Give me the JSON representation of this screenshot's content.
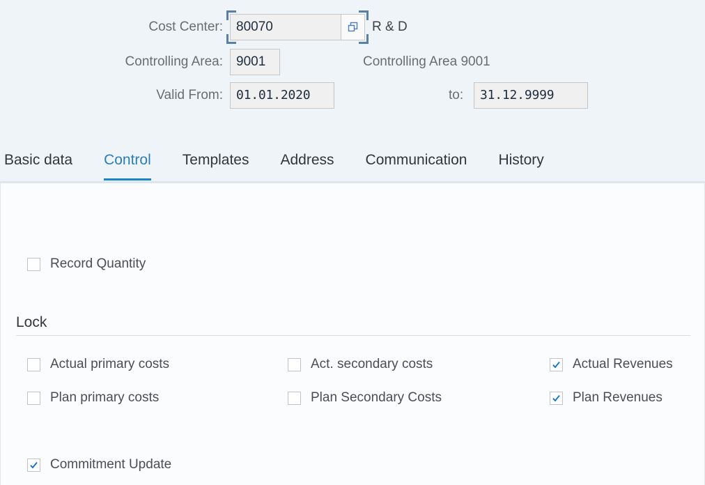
{
  "header": {
    "fields": [
      {
        "label": "Cost Center:",
        "value": "80070",
        "description": "R & D",
        "value_help_icon": "value-help-icon"
      },
      {
        "label": "Controlling Area:",
        "value": "9001",
        "description": "Controlling Area 9001"
      },
      {
        "label": "Valid From:",
        "value": "01.01.2020",
        "to_label": "to:",
        "to_value": "31.12.9999"
      }
    ]
  },
  "tabs": [
    {
      "label": "Basic data",
      "active": false
    },
    {
      "label": "Control",
      "active": true
    },
    {
      "label": "Templates",
      "active": false
    },
    {
      "label": "Address",
      "active": false
    },
    {
      "label": "Communication",
      "active": false
    },
    {
      "label": "History",
      "active": false
    }
  ],
  "content": {
    "record_quantity": {
      "label": "Record Quantity",
      "checked": false
    },
    "lock_section": {
      "title": "Lock",
      "items": [
        {
          "label": "Actual primary costs",
          "checked": false
        },
        {
          "label": "Plan primary costs",
          "checked": false
        },
        {
          "label": "Act. secondary costs",
          "checked": false
        },
        {
          "label": "Plan Secondary Costs",
          "checked": false
        },
        {
          "label": "Actual Revenues",
          "checked": true
        },
        {
          "label": "Plan Revenues",
          "checked": true
        }
      ]
    },
    "commitment_update": {
      "label": "Commitment Update",
      "checked": true
    }
  },
  "colors": {
    "header_background": "#eff4f9",
    "content_background": "#fbfcfe",
    "active_tab": "#2a7eb8",
    "active_tab_underline": "#1d85c4",
    "label_text": "#6a6d70",
    "checkmark": "#0a6ed1",
    "focus_bracket": "#5a7fa6"
  }
}
